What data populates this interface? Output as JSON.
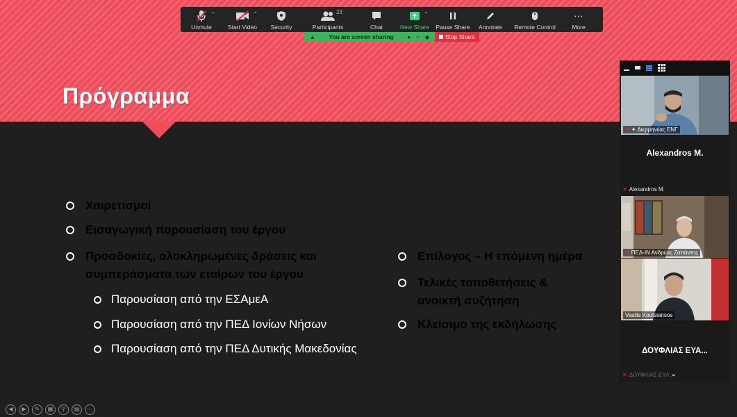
{
  "toolbar": {
    "buttons": [
      {
        "label": "Unmute",
        "icon": "mic-muted-icon"
      },
      {
        "label": "Start Video",
        "icon": "video-off-icon"
      },
      {
        "label": "Security",
        "icon": "shield-icon"
      },
      {
        "label": "Participants",
        "icon": "people-icon",
        "count": "23"
      },
      {
        "label": "Chat",
        "icon": "chat-icon"
      },
      {
        "label": "New Share",
        "icon": "share-arrow-icon"
      },
      {
        "label": "Pause Share",
        "icon": "pause-icon"
      },
      {
        "label": "Annotate",
        "icon": "pen-icon"
      },
      {
        "label": "Remote Control",
        "icon": "mouse-icon"
      },
      {
        "label": "More",
        "icon": "more-dots-icon"
      }
    ],
    "accent_green": "#3ed17a"
  },
  "share_banner": {
    "sharing_text": "You are screen sharing",
    "stop_label": "Stop Share",
    "sharing_color": "#3db35a",
    "stop_color": "#e0303c"
  },
  "slide": {
    "title": "Πρόγραμμα",
    "accent_color": "#ee4d5c",
    "left_items": [
      {
        "text": "Χαιρετισμοί"
      },
      {
        "text": "Εισαγωγική παρουσίαση του έργου"
      },
      {
        "line1": "Προσδοκίες, ολοκληρωμένες δράσεις και",
        "line2": "συμπεράσματα των εταίρων του έργου"
      }
    ],
    "sub_items": [
      "Παρουσίαση από την ΕΣΑμεΑ",
      "Παρουσίαση από την ΠΕΔ Ιονίων Νήσων",
      "Παρουσίαση από την ΠΕΔ Δυτικής Μακεδονίας"
    ],
    "right_items": [
      {
        "text": "Επίλογος – Η επόμενη ημέρα"
      },
      {
        "line1": "Τελικές τοποθετήσεις &",
        "line2": "ανοικτή συζήτηση"
      },
      {
        "text": "Κλείσιμο της εκδήλωσης"
      }
    ]
  },
  "participants": {
    "tile1_name": "Διερμηνέας ΕΝΓ",
    "name_tile_1": "Alexandros M.",
    "label_alexandros": "Alexandros M.",
    "tile2_name": "ΠΕΔ-ΙΝ Ανδρέας Ζαπάντης",
    "tile3_name": "Vasilis Koutsiansos",
    "name_tile_2": "ΔΟΥΦΛΙΑΣ ΕΥΑ...",
    "bottom_partial": "ΔΟΥΦΛΙΑΣ ΕΥΑ..."
  },
  "slide_nav": [
    "prev-icon",
    "next-icon",
    "pen-icon",
    "slides-icon",
    "zoom-icon",
    "subtitles-icon",
    "more-icon"
  ]
}
